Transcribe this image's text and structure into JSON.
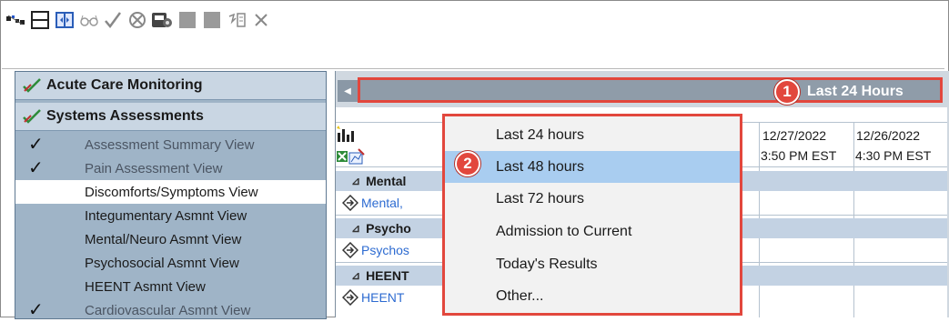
{
  "toolbar": {
    "icons": [
      "link-toggle-icon",
      "table-view-icon",
      "split-view-icon",
      "glasses-icon",
      "checkmark-icon",
      "cancel-circle-icon",
      "printer-icon",
      "gray-block-icon",
      "gray-block-icon-2",
      "sign-icon",
      "close-x-icon"
    ]
  },
  "left_panel": {
    "headers": [
      "Acute Care Monitoring",
      "Systems Assessments"
    ],
    "items": [
      {
        "label": "Assessment Summary View",
        "checked": true,
        "dim": true
      },
      {
        "label": "Pain Assessment View",
        "checked": true,
        "dim": true
      },
      {
        "label": "Discomforts/Symptoms View",
        "checked": false,
        "dim": false,
        "active": true
      },
      {
        "label": "Integumentary Asmnt View",
        "checked": false,
        "dim": false
      },
      {
        "label": "Mental/Neuro Asmnt View",
        "checked": false,
        "dim": false
      },
      {
        "label": "Psychosocial Asmnt View",
        "checked": false,
        "dim": false
      },
      {
        "label": "HEENT Asmnt View",
        "checked": false,
        "dim": false
      },
      {
        "label": "Cardiovascular Asmnt View",
        "checked": true,
        "dim": true
      }
    ],
    "tick_glyph": "✓"
  },
  "range": {
    "label": "Last 24 Hours",
    "arrow": "◀"
  },
  "badges": {
    "one": "1",
    "two": "2"
  },
  "grid": {
    "dates": [
      "12/27/2022",
      "12/26/2022"
    ],
    "times": [
      "3:50 PM EST",
      "4:30 PM EST"
    ],
    "sections": [
      {
        "label": "Mental",
        "link": "Mental,"
      },
      {
        "label": "Psycho",
        "link": "Psychos"
      },
      {
        "label": "HEENT",
        "link": "HEENT"
      }
    ],
    "tri": "⊿"
  },
  "dropdown": {
    "options": [
      "Last 24 hours",
      "Last 48 hours",
      "Last 72 hours",
      "Admission to Current",
      "Today's Results",
      "Other..."
    ],
    "selected_index": 1
  },
  "colors": {
    "highlight": "#e2473d",
    "selection": "#a9cdf0",
    "panel": "#9fb4c7",
    "link": "#2d6bd1"
  }
}
